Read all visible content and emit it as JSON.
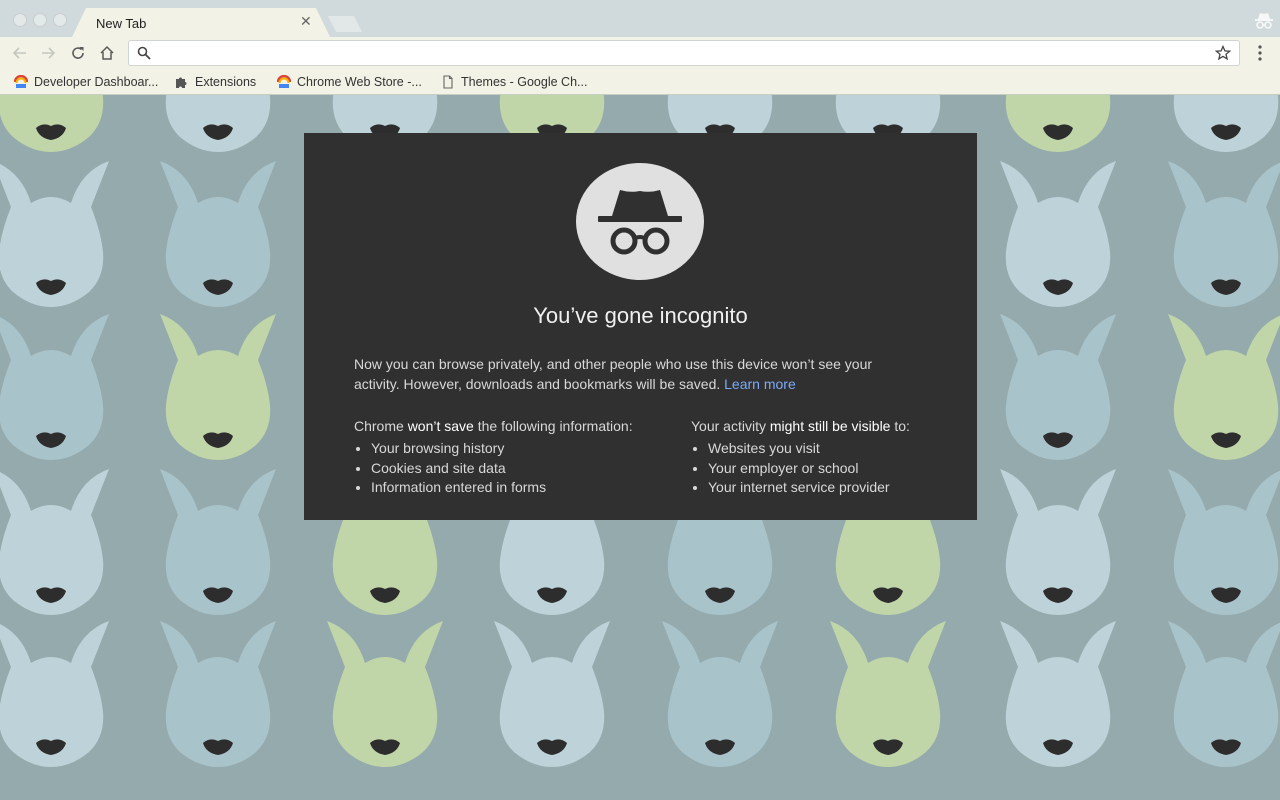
{
  "window": {
    "tab": {
      "title": "New Tab",
      "close_glyph": "✕"
    }
  },
  "toolbar": {
    "omnibox": {
      "value": "",
      "placeholder": ""
    },
    "icons": [
      "back-icon",
      "forward-icon",
      "reload-icon",
      "home-icon",
      "search-icon",
      "star-icon",
      "more-menu-icon"
    ]
  },
  "bookmarks": [
    {
      "label": "Developer Dashboar...",
      "icon": "chrome-web-store-icon"
    },
    {
      "label": "Extensions",
      "icon": "puzzle-piece-icon"
    },
    {
      "label": "Chrome Web Store -...",
      "icon": "chrome-web-store-icon"
    },
    {
      "label": "Themes - Google Ch...",
      "icon": "page-icon"
    }
  ],
  "incognito": {
    "title": "You’ve gone incognito",
    "description": "Now you can browse privately, and other people who use this device won’t see your activity. However, downloads and bookmarks will be saved.",
    "learn_more": "Learn more",
    "left": {
      "head_prefix": "Chrome",
      "head_bold": "won’t save",
      "head_suffix": "the following information:",
      "items": [
        "Your browsing history",
        "Cookies and site data",
        "Information entered in forms"
      ]
    },
    "right": {
      "head_prefix": "Your activity",
      "head_bold": "might still be visible",
      "head_suffix": "to:",
      "items": [
        "Websites you visit",
        "Your employer or school",
        "Your internet service provider"
      ]
    }
  },
  "theme": {
    "background": "#95aaac",
    "dog_colors": [
      "#c0d5a8",
      "#bed3d9",
      "#a9c3cb"
    ],
    "nose_color": "#2d2d2d",
    "card_background": "#303030",
    "link_color": "#7baaf7",
    "frame_color": "#f3f2e6"
  }
}
